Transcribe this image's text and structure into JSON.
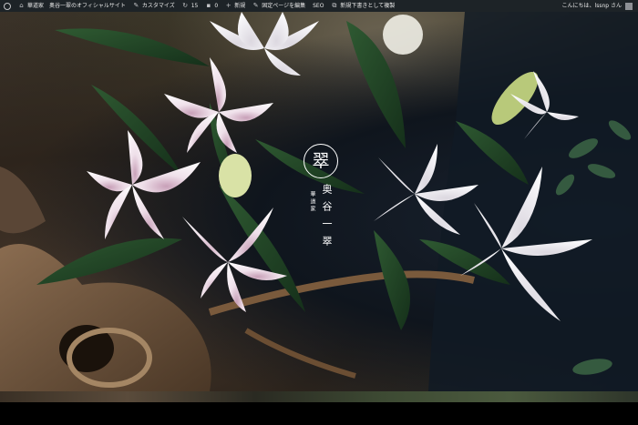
{
  "admin_bar": {
    "site_name": "華道家　奥谷一翠のオフィシャルサイト",
    "customize": "カスタマイズ",
    "updates": "15",
    "comments": "0",
    "new": "新規",
    "edit_page": "固定ページを編集",
    "seo": "SEO",
    "duplicate": "新規下書きとして複製",
    "greeting": "こんにちは、lssnp さん"
  },
  "logo": {
    "mark": "翠",
    "subtitle": "華道家",
    "name": "奥谷一翠"
  }
}
